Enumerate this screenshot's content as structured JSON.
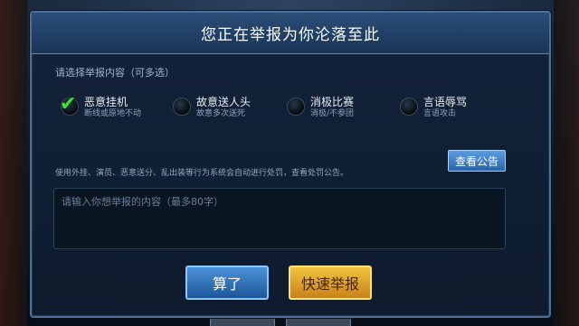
{
  "dialog": {
    "title": "您正在举报为你沦落至此",
    "section_label": "请选择举报内容（可多选）",
    "options": [
      {
        "label": "恶意挂机",
        "sub": "断线或原地不动",
        "checked": true
      },
      {
        "label": "故意送人头",
        "sub": "故意多次送死",
        "checked": false
      },
      {
        "label": "消极比赛",
        "sub": "消极/不参团",
        "checked": false
      },
      {
        "label": "言语辱骂",
        "sub": "言语攻击",
        "checked": false
      }
    ],
    "notice": "使用外挂、演员、恶意送分、乱出装等行为系统会自动进行处罚，查看处罚公告。",
    "view_notice_label": "查看公告",
    "input_placeholder": "请输入你想举报的内容（最多80字）",
    "cancel_label": "算了",
    "report_label": "快速举报"
  },
  "colors": {
    "accent_blue": "#4b6f96",
    "check_green": "#3ee03b",
    "report_gold": "#f2c440"
  }
}
